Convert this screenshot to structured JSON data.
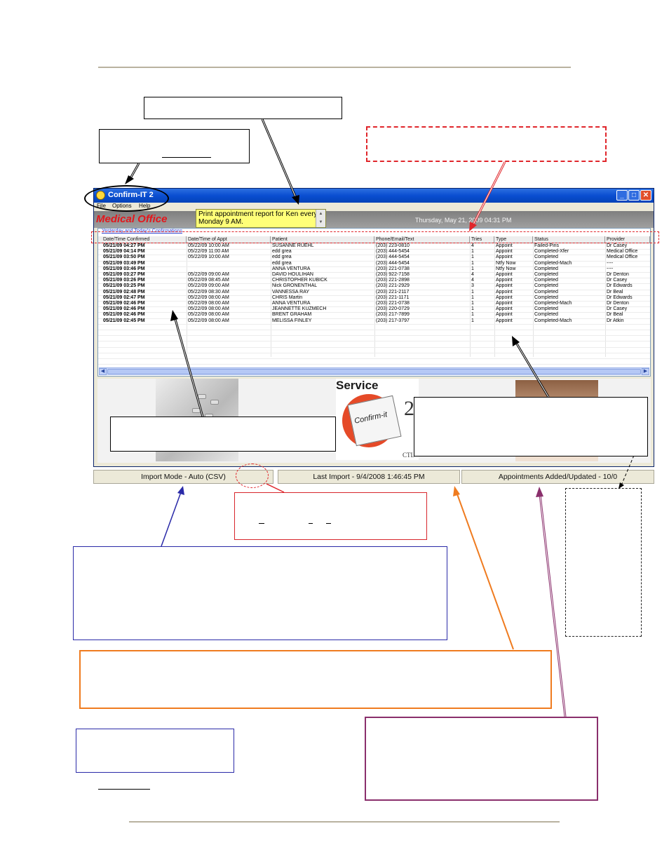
{
  "app": {
    "title": "Confirm-IT 2",
    "window_buttons": [
      "_",
      "□",
      "✕"
    ],
    "menu": [
      "File",
      "Options",
      "Help"
    ],
    "brand": "Medical Office",
    "marquee": "Print appointment report for Ken every Monday 9 AM.",
    "datetime": "Thursday, May 21, 2009 04:31 PM",
    "grid_title": "Yesterday and Today's Confirmations",
    "columns": [
      "Date/Time Confirmed",
      "Date/Time of Appt",
      "Patient",
      "Phone/Email/Text",
      "Tries",
      "Type",
      "Status",
      "Provider"
    ],
    "rows": [
      [
        "05/21/09 04:27 PM",
        "05/22/09 10:00 AM",
        "SUSANNE RUEHL",
        "(203) 223-0810",
        "4",
        "Appoint",
        "Failed-Pins",
        "Dr Casey"
      ],
      [
        "05/21/09 04:14 PM",
        "05/22/09 11:00 AM",
        "edd grea",
        "(203) 444-5454",
        "1",
        "Appoint",
        "Completed-Xfer",
        "Medical Office"
      ],
      [
        "05/21/09 03:50 PM",
        "05/22/09 10:00 AM",
        "edd grea",
        "(203) 444-5454",
        "1",
        "Appoint",
        "Completed",
        "Medical Office"
      ],
      [
        "05/21/09 03:49 PM",
        "",
        "edd grea",
        "(203) 444-5454",
        "1",
        "Ntfy Now",
        "Completed-Mach",
        "----"
      ],
      [
        "05/21/09 03:46 PM",
        "",
        "ANNA VENTURA",
        "(203) 221-0738",
        "1",
        "Ntfy Now",
        "Completed",
        "----"
      ],
      [
        "05/21/09 03:27 PM",
        "05/22/09 09:00 AM",
        "DAVID HOULIHAN",
        "(203) 922-7158",
        "4",
        "Appoint",
        "Completed",
        "Dr Denton"
      ],
      [
        "05/21/09 03:26 PM",
        "05/22/09 08:45 AM",
        "CHRISTOPHER KUBICK",
        "(203) 221-2898",
        "4",
        "Appoint",
        "Completed",
        "Dr Casey"
      ],
      [
        "05/21/09 03:25 PM",
        "05/22/09 09:00 AM",
        "Nick GRONENTHAL",
        "(203) 221-2929",
        "3",
        "Appoint",
        "Completed",
        "Dr Edwards"
      ],
      [
        "05/21/09 02:48 PM",
        "05/22/09 08:30 AM",
        "VANNESSA RAY",
        "(203) 221-2117",
        "1",
        "Appoint",
        "Completed",
        "Dr Beal"
      ],
      [
        "05/21/09 02:47 PM",
        "05/22/09 08:00 AM",
        "CHRIS Martin",
        "(203) 221-1171",
        "1",
        "Appoint",
        "Completed",
        "Dr Edwards"
      ],
      [
        "05/21/09 02:46 PM",
        "05/22/09 08:00 AM",
        "ANNA VENTURA",
        "(203) 221-0738",
        "1",
        "Appoint",
        "Completed-Mach",
        "Dr Denton"
      ],
      [
        "05/21/09 02:46 PM",
        "05/22/09 08:00 AM",
        "JEANNETTE KUZMECH",
        "(203) 220-0729",
        "1",
        "Appoint",
        "Completed",
        "Dr Casey"
      ],
      [
        "05/21/09 02:46 PM",
        "05/22/09 08:00 AM",
        "BRENT GRAHAM",
        "(203) 217-7899",
        "1",
        "Appoint",
        "Completed",
        "Dr Beal"
      ],
      [
        "05/21/09 02:45 PM",
        "05/22/09 08:00 AM",
        "MELISSA FINLEY",
        "(203) 217-3797",
        "1",
        "Appoint",
        "Completed-Mach",
        "Dr Atkin"
      ]
    ],
    "logo": {
      "service": "Service",
      "confirm": "Confirm-it",
      "two": "2",
      "ctl": "CTL"
    },
    "status": {
      "import_mode": "Import Mode - Auto (CSV)",
      "last_import": "Last Import - 9/4/2008 1:46:45 PM",
      "appointments": "Appointments Added/Updated - 10/0"
    }
  },
  "colors": {
    "brand_red": "#e4161b",
    "titlebar_blue": "#0a4ed1",
    "marquee_yellow": "#ffff78",
    "callout_red": "#e0262b",
    "callout_blue": "#2a2aa8",
    "callout_orange": "#ef7b1f",
    "callout_purple": "#8a2f6c"
  }
}
